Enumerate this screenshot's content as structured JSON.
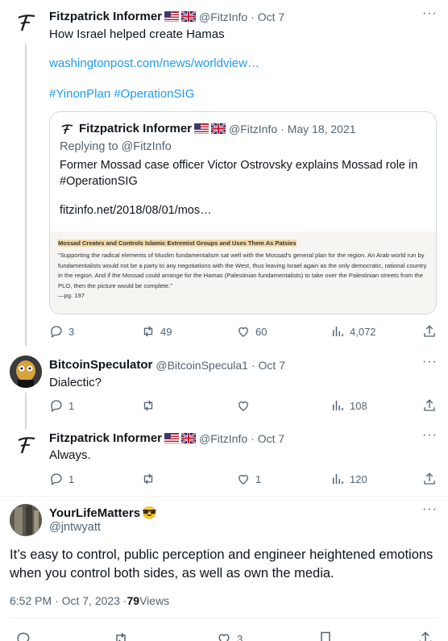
{
  "tweets": [
    {
      "name": "Fitzpatrick Informer",
      "handle": "@FitzInfo",
      "date": "· Oct 7",
      "text": "How Israel helped create Hamas",
      "link": "washingtonpost.com/news/worldview…",
      "hashtags": "#YinonPlan #OperationSIG",
      "replies": "3",
      "retweets": "49",
      "likes": "60",
      "views": "4,072"
    },
    {
      "name": "BitcoinSpeculator",
      "handle": "@BitcoinSpecula1",
      "date": "· Oct 7",
      "text": "Dialectic?",
      "replies": "1",
      "retweets": "",
      "likes": "",
      "views": "108"
    },
    {
      "name": "Fitzpatrick Informer",
      "handle": "@FitzInfo",
      "date": "· Oct 7",
      "text": "Always.",
      "replies": "1",
      "retweets": "",
      "likes": "1",
      "views": "120"
    }
  ],
  "quote": {
    "name": "Fitzpatrick Informer",
    "handle": "@FitzInfo",
    "date": "· May 18, 2021",
    "replying": "Replying to @FitzInfo",
    "text": "Former Mossad case officer Victor Ostrovsky explains Mossad role in #OperationSIG",
    "link": "fitzinfo.net/2018/08/01/mos…",
    "doc_title": "Mossad Creates and Controls Islamic Extremist Groups and Uses Them As Patsies",
    "doc_text": "\"Supporting the radical elements of Muslim fundamentalism sat well with the Mossad's general plan for the region. An Arab world run by fundamentalists would not be a party to any negotiations with the West, thus leaving Israel again as the only democratic, rational country in the region. And if the Mossad could arrange for the Hamas (Palestinian fundamentalists) to take over the Palestinian streets from the PLO, then the picture would be complete.\"",
    "doc_page": "—pg. 197"
  },
  "main": {
    "name": "YourLifeMatters",
    "emoji": "😎",
    "handle": "@jntwyatt",
    "text": "It’s easy to control, public perception and engineer heightened emotions when you control both sides, as well as own the media.",
    "time": "6:52 PM · Oct 7, 2023 · ",
    "views_count": "79",
    "views_label": " Views",
    "replies": "",
    "retweets": "",
    "likes": "3"
  },
  "colors": {
    "accent": "#1d9bf0",
    "muted": "#536471",
    "text": "#0f1419",
    "border": "#cfd9de"
  }
}
